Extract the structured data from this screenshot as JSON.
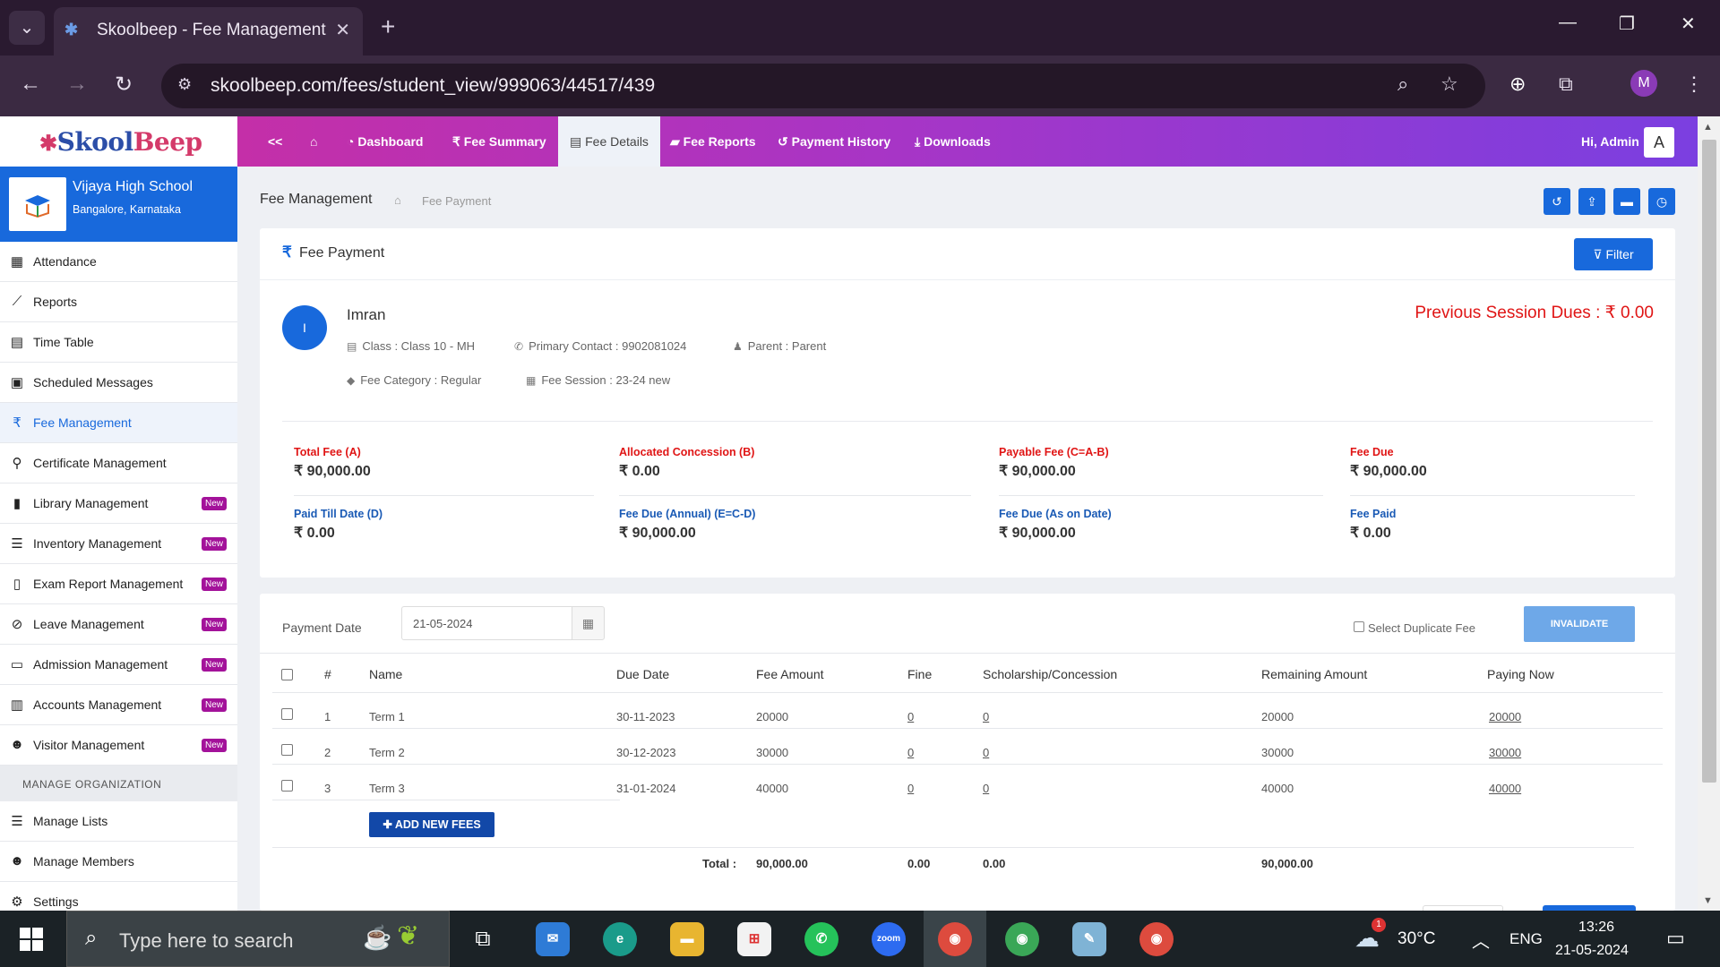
{
  "browser": {
    "tab_title": "Skoolbeep - Fee Management",
    "url": "skoolbeep.com/fees/student_view/999063/44517/439",
    "profile_initial": "M"
  },
  "app": {
    "logo_main": "Skool",
    "logo_accent": "Beep",
    "nav": {
      "collapse": "<<",
      "items": [
        "Dashboard",
        "Fee Summary",
        "Fee Details",
        "Fee Reports",
        "Payment History",
        "Downloads"
      ],
      "greeting": "Hi, Admin",
      "avatar": "A"
    }
  },
  "sidebar": {
    "school_name": "Vijaya High School",
    "school_location": "Bangalore, Karnataka",
    "items": [
      {
        "label": "Attendance",
        "icon": "calendar-icon"
      },
      {
        "label": "Reports",
        "icon": "chart-icon"
      },
      {
        "label": "Time Table",
        "icon": "table-icon"
      },
      {
        "label": "Scheduled Messages",
        "icon": "calendar-check-icon"
      },
      {
        "label": "Fee Management",
        "icon": "rupee-icon"
      },
      {
        "label": "Certificate Management",
        "icon": "award-icon"
      },
      {
        "label": "Library Management",
        "icon": "book-icon",
        "badge": "New"
      },
      {
        "label": "Inventory Management",
        "icon": "list-icon",
        "badge": "New"
      },
      {
        "label": "Exam Report Management",
        "icon": "document-icon",
        "badge": "New"
      },
      {
        "label": "Leave Management",
        "icon": "user-slash-icon",
        "badge": "New"
      },
      {
        "label": "Admission Management",
        "icon": "id-card-icon",
        "badge": "New"
      },
      {
        "label": "Accounts Management",
        "icon": "ledger-icon",
        "badge": "New"
      },
      {
        "label": "Visitor Management",
        "icon": "users-icon",
        "badge": "New"
      }
    ],
    "section": "MANAGE ORGANIZATION",
    "org_items": [
      {
        "label": "Manage Lists",
        "icon": "list-icon"
      },
      {
        "label": "Manage Members",
        "icon": "users-icon"
      },
      {
        "label": "Settings",
        "icon": "gear-icon"
      }
    ]
  },
  "breadcrumb": {
    "title": "Fee Management",
    "page": "Fee Payment"
  },
  "fee_card": {
    "title": "Fee Payment",
    "filter_label": "Filter",
    "student": {
      "initial": "I",
      "name": "Imran",
      "class": "Class : Class 10 - MH",
      "contact": "Primary Contact : 9902081024",
      "parent": "Parent : Parent",
      "fee_category": "Fee Category : Regular",
      "fee_session": "Fee Session : 23-24 new"
    },
    "previous_dues": "Previous Session Dues : ₹ 0.00",
    "stats": [
      {
        "label": "Total Fee (A)",
        "value": "₹ 90,000.00"
      },
      {
        "label": "Allocated Concession (B)",
        "value": "₹ 0.00"
      },
      {
        "label": "Payable Fee (C=A-B)",
        "value": "₹ 90,000.00"
      },
      {
        "label": "Fee Due",
        "value": "₹ 90,000.00"
      },
      {
        "label": "Paid Till Date (D)",
        "value": "₹ 0.00"
      },
      {
        "label": "Fee Due (Annual) (E=C-D)",
        "value": "₹ 90,000.00"
      },
      {
        "label": "Fee Due (As on Date)",
        "value": "₹ 90,000.00"
      },
      {
        "label": "Fee Paid",
        "value": "₹ 0.00"
      }
    ]
  },
  "payment": {
    "date_label": "Payment Date",
    "date_value": "21-05-2024",
    "duplicate_label": "Select Duplicate Fee",
    "invalidate_label": "INVALIDATE",
    "columns": [
      "#",
      "Name",
      "Due Date",
      "Fee Amount",
      "Fine",
      "Scholarship/Concession",
      "Remaining Amount",
      "Paying Now"
    ],
    "rows": [
      {
        "num": "1",
        "name": "Term 1",
        "due": "30-11-2023",
        "amount": "20000",
        "fine": "0",
        "concession": "0",
        "remaining": "20000",
        "paying": "20000"
      },
      {
        "num": "2",
        "name": "Term 2",
        "due": "30-12-2023",
        "amount": "30000",
        "fine": "0",
        "concession": "0",
        "remaining": "30000",
        "paying": "30000"
      },
      {
        "num": "3",
        "name": "Term 3",
        "due": "31-01-2024",
        "amount": "40000",
        "fine": "0",
        "concession": "0",
        "remaining": "40000",
        "paying": "40000"
      }
    ],
    "add_label": "ADD NEW FEES",
    "totals": {
      "label": "Total :",
      "amount": "90,000.00",
      "fine": "0.00",
      "concession": "0.00",
      "remaining": "90,000.00"
    }
  },
  "taskbar": {
    "search_placeholder": "Type here to search",
    "weather": "30°C",
    "weather_badge": "1",
    "lang": "ENG",
    "time": "13:26",
    "date": "21-05-2024",
    "zoom_label": "zoom"
  }
}
